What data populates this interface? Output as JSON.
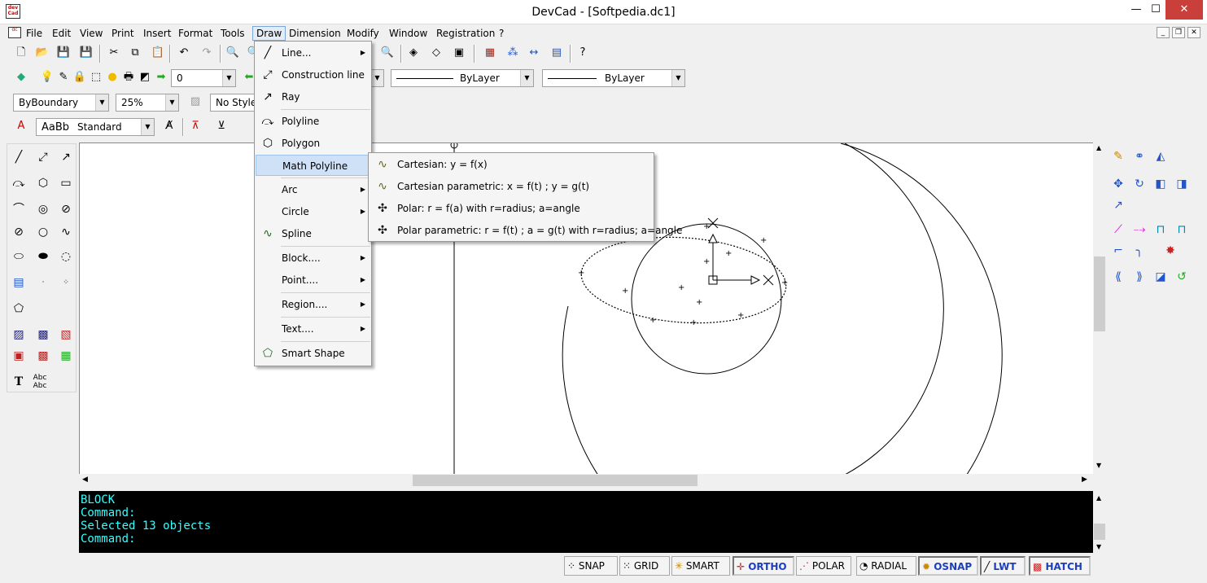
{
  "window": {
    "title": "DevCad - [Softpedia.dc1]",
    "minimize": "—",
    "maximize": "☐",
    "close": "✕"
  },
  "menubar": [
    "File",
    "Edit",
    "View",
    "Print",
    "Insert",
    "Format",
    "Tools",
    "Draw",
    "Dimension",
    "Modify",
    "Window",
    "Registration",
    "?"
  ],
  "toolbar": {
    "layer_value": "0",
    "linetype1": "ByLayer",
    "linetype2": "ByLayer",
    "boundary": "ByBoundary",
    "zoom": "25%",
    "style": "No Style",
    "textstyle_preview": "AaBb",
    "textstyle": "Standard"
  },
  "draw_menu": {
    "items": [
      {
        "label": "Line...",
        "icon": "line-icon",
        "sub": true
      },
      {
        "label": "Construction line",
        "icon": "construction-line-icon",
        "sub": false
      },
      {
        "label": "Ray",
        "icon": "ray-icon",
        "sub": false
      },
      {
        "label": "Polyline",
        "icon": "polyline-icon",
        "sub": false
      },
      {
        "label": "Polygon",
        "icon": "polygon-icon",
        "sub": false
      },
      {
        "label": "Math Polyline",
        "icon": "math-polyline-icon",
        "sub": false
      },
      {
        "label": "Arc",
        "icon": "arc-icon",
        "sub": true
      },
      {
        "label": "Circle",
        "icon": "circle-icon",
        "sub": true
      },
      {
        "label": "Spline",
        "icon": "spline-icon",
        "sub": false
      },
      {
        "label": "Block....",
        "icon": "block-icon",
        "sub": true
      },
      {
        "label": "Point....",
        "icon": "point-icon",
        "sub": true
      },
      {
        "label": "Region....",
        "icon": "region-icon",
        "sub": true
      },
      {
        "label": "Text....",
        "icon": "text-icon",
        "sub": true
      },
      {
        "label": "Smart Shape",
        "icon": "smart-shape-icon",
        "sub": false
      }
    ]
  },
  "math_submenu": [
    "Cartesian: y = f(x)",
    "Cartesian parametric: x = f(t) ; y = g(t)",
    "Polar: r = f(a)  with r=radius; a=angle",
    "Polar parametric: r = f(t) ; a = g(t) with r=radius; a=angle"
  ],
  "command_lines": [
    "BLOCK",
    "Command:",
    "Selected 13 objects",
    "Command:"
  ],
  "status": [
    {
      "label": "SNAP",
      "on": false
    },
    {
      "label": "GRID",
      "on": false
    },
    {
      "label": "SMART",
      "on": false
    },
    {
      "label": "ORTHO",
      "on": true
    },
    {
      "label": "POLAR",
      "on": false
    },
    {
      "label": "RADIAL",
      "on": false
    },
    {
      "label": "OSNAP",
      "on": true
    },
    {
      "label": "LWT",
      "on": true
    },
    {
      "label": "HATCH",
      "on": true
    }
  ],
  "colors": {
    "command_bg": "#000000",
    "command_fg": "#33ffff",
    "status_on": "#1c3fbf",
    "menu_highlight": "#cfe1f6"
  }
}
